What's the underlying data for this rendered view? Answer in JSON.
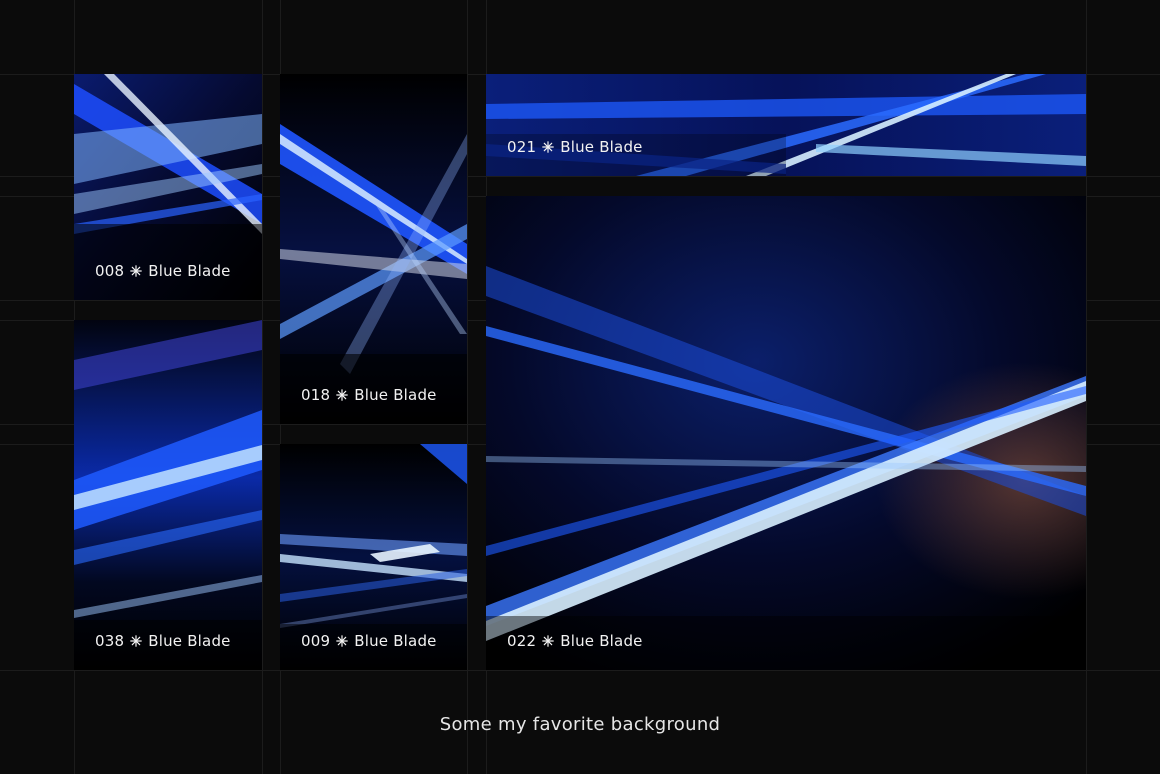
{
  "tiles": [
    {
      "number": "008",
      "name": "Blue Blade"
    },
    {
      "number": "018",
      "name": "Blue Blade"
    },
    {
      "number": "021",
      "name": "Blue Blade"
    },
    {
      "number": "038",
      "name": "Blue Blade"
    },
    {
      "number": "009",
      "name": "Blue Blade"
    },
    {
      "number": "022",
      "name": "Blue Blade"
    }
  ],
  "separator_icon": "asterisk-icon",
  "footer": {
    "text": "Some my favorite background"
  },
  "colors": {
    "background": "#0b0b0b",
    "accent_blue": "#1e5bff",
    "highlight": "#bfe2ff",
    "text": "#f2f2f2"
  }
}
